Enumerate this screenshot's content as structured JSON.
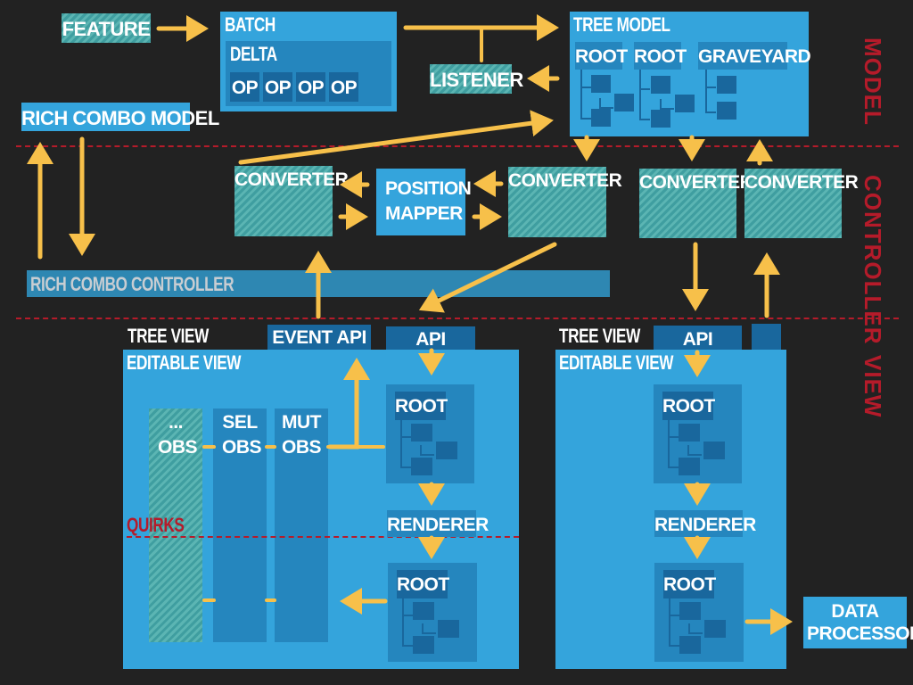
{
  "sections": {
    "model": "MODEL",
    "controller": "CONTROLLER",
    "view": "VIEW",
    "divider_color": "#b51b2a"
  },
  "colors": {
    "background": "#222222",
    "primary_block": "#34a4dc",
    "secondary_block": "#2586be",
    "tertiary_block": "#19679d",
    "teal_block": "#4aa8a8",
    "arrow": "#f7c04a"
  },
  "model": {
    "feature": "FEATURE",
    "batch": {
      "title": "BATCH",
      "delta": {
        "title": "DELTA",
        "ops": [
          "OP",
          "OP",
          "OP",
          "OP"
        ]
      }
    },
    "listener": "LISTENER",
    "tree_model": {
      "title": "TREE MODEL",
      "roots": [
        "ROOT",
        "ROOT",
        "GRAVEYARD"
      ]
    },
    "rich_combo_model": "RICH COMBO MODEL"
  },
  "controller": {
    "converters": [
      "CONVERTER",
      "CONVERTER",
      "CONVERTER",
      "CONVERTER"
    ],
    "position_mapper": "POSITION MAPPER",
    "rich_combo_controller": "RICH COMBO CONTROLLER"
  },
  "view": {
    "left": {
      "tree_view": "TREE VIEW",
      "event_api": "EVENT API",
      "api": "API",
      "editable_view": "EDITABLE VIEW",
      "observers": [
        "... OBS",
        "SEL OBS",
        "MUT OBS"
      ],
      "quirks": "QUIRKS",
      "root_top": "ROOT",
      "renderer": "RENDERER",
      "root_bottom": "ROOT"
    },
    "right": {
      "tree_view": "TREE VIEW",
      "api": "API",
      "editable_view": "EDITABLE VIEW",
      "root_top": "ROOT",
      "renderer": "RENDERER",
      "root_bottom": "ROOT"
    },
    "data_processor": "DATA PROCESSOR"
  }
}
